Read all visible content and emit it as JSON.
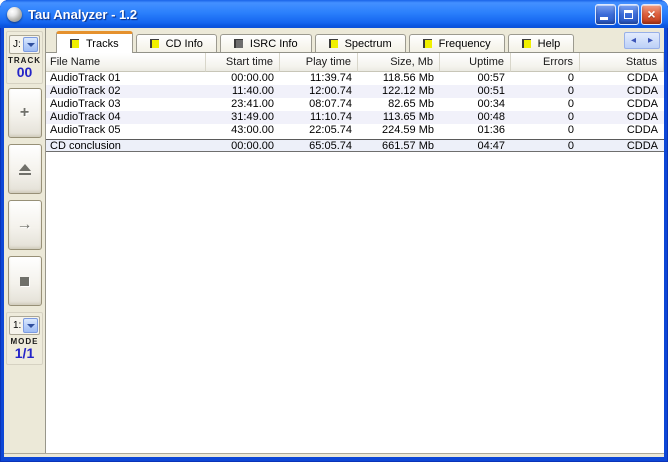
{
  "window": {
    "title": "Tau Analyzer - 1.2",
    "controls": {
      "close_glyph": "×"
    }
  },
  "colors": {
    "titlebar_blue": "#2b80fc",
    "window_border": "#0d47d6",
    "panel_beige": "#ece9d8",
    "active_tab_stripe": "#e5912d",
    "alt_row": "#f1f1fa",
    "accent_text_blue": "#2424c8",
    "tab_icon_yellow": "#f0f000",
    "tab_icon_grey": "#6e6e6e"
  },
  "sidebar": {
    "drive_selector": {
      "value": "J:"
    },
    "track": {
      "label": "TRACK",
      "value": "00"
    },
    "buttons": [
      {
        "name": "add",
        "glyph": "+"
      },
      {
        "name": "eject",
        "glyph": "eject-shape"
      },
      {
        "name": "go",
        "glyph": "→"
      },
      {
        "name": "stop",
        "glyph": "stop-shape"
      }
    ],
    "mode_selector": {
      "value": "1:"
    },
    "mode": {
      "label": "MODE",
      "value": "1/1"
    }
  },
  "tabs": {
    "items": [
      {
        "label": "Tracks",
        "active": true
      },
      {
        "label": "CD Info",
        "active": false
      },
      {
        "label": "ISRC Info",
        "active": false
      },
      {
        "label": "Spectrum",
        "active": false
      },
      {
        "label": "Frequency",
        "active": false
      },
      {
        "label": "Help",
        "active": false
      }
    ],
    "scroll_left_glyph": "◂",
    "scroll_right_glyph": "▸"
  },
  "table": {
    "columns": [
      "File Name",
      "Start time",
      "Play time",
      "Size, Mb",
      "Uptime",
      "Errors",
      "Status"
    ],
    "rows": [
      [
        "AudioTrack 01",
        "00:00.00",
        "11:39.74",
        "118.56 Mb",
        "00:57",
        "0",
        "CDDA"
      ],
      [
        "AudioTrack 02",
        "11:40.00",
        "12:00.74",
        "122.12 Mb",
        "00:51",
        "0",
        "CDDA"
      ],
      [
        "AudioTrack 03",
        "23:41.00",
        "08:07.74",
        "82.65 Mb",
        "00:34",
        "0",
        "CDDA"
      ],
      [
        "AudioTrack 04",
        "31:49.00",
        "11:10.74",
        "113.65 Mb",
        "00:48",
        "0",
        "CDDA"
      ],
      [
        "AudioTrack 05",
        "43:00.00",
        "22:05.74",
        "224.59 Mb",
        "01:36",
        "0",
        "CDDA"
      ]
    ],
    "summary_row": [
      "CD conclusion",
      "00:00.00",
      "65:05.74",
      "661.57 Mb",
      "04:47",
      "0",
      "CDDA"
    ]
  }
}
